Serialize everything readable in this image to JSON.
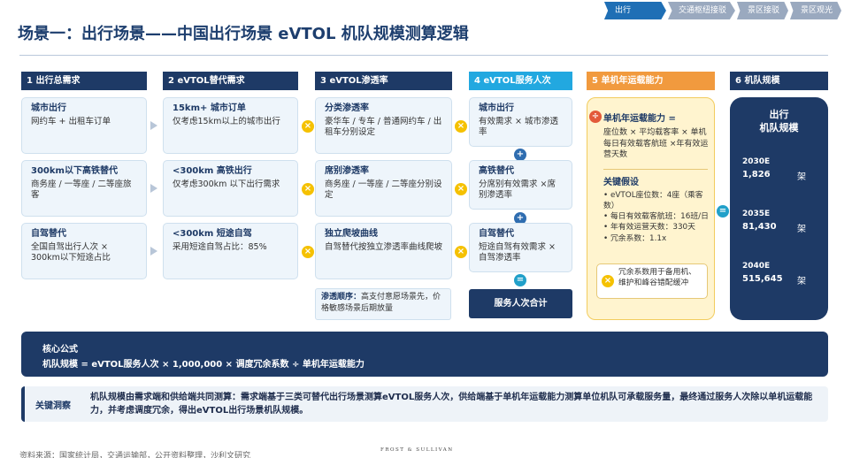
{
  "nav": {
    "tabs": [
      "出行",
      "交通枢纽接驳",
      "景区接驳",
      "景区观光"
    ]
  },
  "title": "场景一：出行场景——中国出行场景 eVTOL 机队规模测算逻辑",
  "columns": {
    "c1": "1 出行总需求",
    "c2": "2 eVTOL替代需求",
    "c3": "3 eVTOL渗透率",
    "c4": "4 eVTOL服务人次",
    "c5": "5 单机年运载能力",
    "c6": "6 机队规模"
  },
  "col1": [
    {
      "title": "城市出行",
      "body": "网约车 + 出租车订单"
    },
    {
      "title": "300km以下高铁替代",
      "body": "商务座 / 一等座 / 二等座旅客"
    },
    {
      "title": "自驾替代",
      "body": "全国自驾出行人次 × 300km以下短途占比"
    }
  ],
  "col2": [
    {
      "title": "15km+ 城市订单",
      "body": "仅考虑15km以上的城市出行"
    },
    {
      "title": "<300km 高铁出行",
      "body": "仅考虑300km 以下出行需求"
    },
    {
      "title": "<300km 短途自驾",
      "body": "采用短途自驾占比：85%"
    }
  ],
  "col3": [
    {
      "title": "分类渗透率",
      "body": "豪华车 / 专车 / 普通网约车 / 出租车分别设定"
    },
    {
      "title": "席别渗透率",
      "body": "商务座 / 一等座 / 二等座分别设定"
    },
    {
      "title": "独立爬坡曲线",
      "body": "自驾替代按独立渗透率曲线爬坡"
    }
  ],
  "order": {
    "label": "渗透顺序：",
    "text": "高支付意愿场景先，价格敏感场景后期放量"
  },
  "col4": [
    {
      "title": "城市出行",
      "body": "有效需求 × 城市渗透率"
    },
    {
      "title": "高铁替代",
      "body": "分席别有效需求 ×席别渗透率"
    },
    {
      "title": "自驾替代",
      "body": "短途自驾有效需求 × 自驾渗透率"
    }
  ],
  "sum_label": "服务人次合计",
  "capacity": {
    "formula_title": "单机年运载能力 =",
    "formula_body": "座位数 × 平均载客率 × 单机每日有效载客航班 ×年有效运营天数",
    "assume_title": "关键假设",
    "assumptions": [
      "• eVTOL座位数：4座（乘客数）",
      "• 每日有效载客航班：16班/日",
      "• 年有效运营天数：330天",
      "• 冗余系数：1.1x"
    ],
    "note": "冗余系数用于备用机、维护和峰谷错配缓冲"
  },
  "fleet": {
    "title": "出行\n机队规模",
    "unit": "架",
    "rows": [
      {
        "year": "2030E",
        "value": "1,826"
      },
      {
        "year": "2035E",
        "value": "81,430"
      },
      {
        "year": "2040E",
        "value": "515,645"
      }
    ]
  },
  "formula": {
    "title": "核心公式",
    "text": "机队规模 = eVTOL服务人次 × 1,000,000 × 调度冗余系数 ÷ 单机年运载能力"
  },
  "insight": {
    "title": "关键洞察",
    "text": "机队规模由需求端和供给端共同测算：需求端基于三类可替代出行场景测算eVTOL服务人次，供给端基于单机年运载能力测算单位机队可承载服务量，最终通过服务人次除以单机运载能力，并考虑调度冗余，得出eVTOL出行场景机队规模。"
  },
  "footer": {
    "source": "资料来源：国家统计局，交通运输部，公开资料整理，沙利文研究",
    "logo": "FROST & SULLIVAN"
  },
  "operators": {
    "multiply": "×",
    "plus": "+",
    "equals": "=",
    "divide": "÷"
  },
  "colors": {
    "navy": "#1e3a66",
    "cyan": "#22a8e0",
    "orange": "#f19a3e",
    "yellow": "#f5c100",
    "panel": "#fff4cf"
  }
}
